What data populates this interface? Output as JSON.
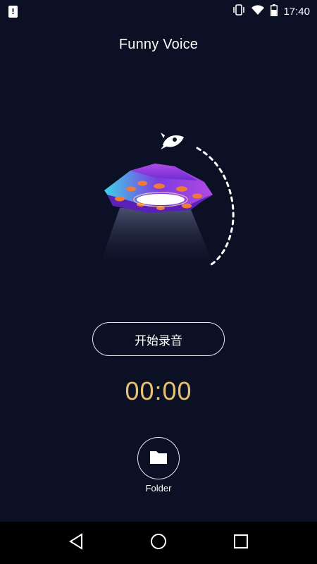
{
  "status_bar": {
    "time": "17:40",
    "sim_alert_icon": "!",
    "icons": [
      "vibrate-icon",
      "wifi-icon",
      "battery-icon"
    ]
  },
  "app": {
    "title": "Funny Voice"
  },
  "recording": {
    "start_button_label": "开始录音",
    "timer": "00:00"
  },
  "folder": {
    "label": "Folder",
    "icon": "folder-icon"
  },
  "nav": {
    "items": [
      "back-icon",
      "home-icon",
      "recents-icon"
    ]
  },
  "colors": {
    "background": "#0b1024",
    "timer": "#e7c173",
    "ufo_top": "#8a3ee0",
    "ufo_accent": "#3fd0e8",
    "ufo_lights": "#f07a3a"
  }
}
